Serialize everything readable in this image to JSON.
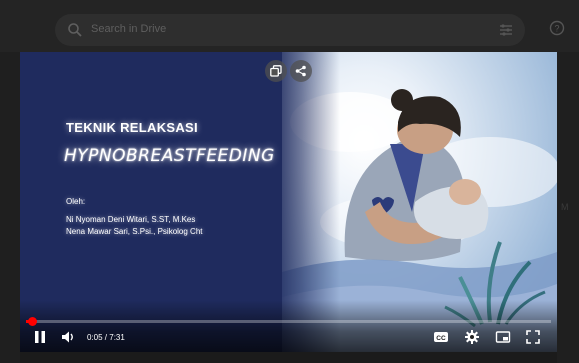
{
  "drive": {
    "search_placeholder": "Search in Drive",
    "side_peek": "M"
  },
  "slide": {
    "title": "TEKNIK RELAKSASI",
    "subtitle": "HYPNOBREASTFEEDING",
    "by_label": "Oleh:",
    "authors": [
      "Ni Nyoman Deni Witari, S.ST, M.Kes",
      "Nena Mawar Sari, S.Psi., Psikolog Cht"
    ]
  },
  "player": {
    "current_time": "0:05",
    "duration": "7:31",
    "time_display": "0:05 / 7:31",
    "progress": 0.011,
    "accent_color": "#ff0000"
  },
  "colors": {
    "slide_navy": "#1f2b5e",
    "sky_light": "#e9f0f8",
    "sky_blue": "#8fb0d4"
  },
  "icons": [
    "search-icon",
    "filter-icon",
    "help-icon",
    "copy-icon",
    "share-icon",
    "pause-icon",
    "volume-icon",
    "captions-icon",
    "settings-icon",
    "miniplayer-icon",
    "fullscreen-icon"
  ]
}
